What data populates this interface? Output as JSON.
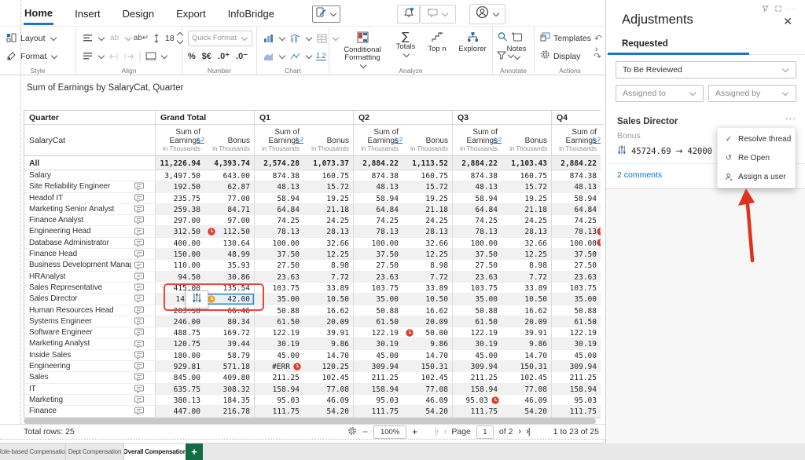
{
  "menu": {
    "items": [
      "Home",
      "Insert",
      "Design",
      "Export",
      "InfoBridge"
    ],
    "active": "Home"
  },
  "ribbon": {
    "style_label": "Style",
    "align_label": "Align",
    "number_label": "Number",
    "chart_label": "Chart",
    "analyze_label": "Analyze",
    "annotate_label": "Annotate",
    "actions_label": "Actions",
    "layout": "Layout",
    "format": "Format",
    "font_size": "18",
    "quick_format": "Quick Format",
    "number_glyphs": [
      "%",
      "$€",
      ".0⁺",
      ".0⁻"
    ],
    "chart_badge": "1.2",
    "conditional_formatting": "Conditional Formatting",
    "totals": "Totals",
    "top_n": "Top n",
    "explorer": "Explorer",
    "notes": "Notes",
    "templates": "Templates",
    "display": "Display"
  },
  "table": {
    "title": "Sum of Earnings by SalaryCat, Quarter",
    "corner_top": "Quarter",
    "corner_bottom": "SalaryCat",
    "quarter_headers": [
      "Grand Total",
      "Q1",
      "Q2",
      "Q3",
      "Q4"
    ],
    "measure": {
      "sum": "Sum of Earnings",
      "bonus": "Bonus",
      "unit": "in Thousands",
      "scale_badge": "1.2"
    },
    "rows": [
      {
        "name": "All",
        "bold": true,
        "shaded": true,
        "values": [
          "11,226.94",
          "4,393.74",
          "2,574.28",
          "1,073.37",
          "2,884.22",
          "1,113.52",
          "2,884.22",
          "1,103.43",
          "2,884.22"
        ]
      },
      {
        "name": "Salary",
        "values": [
          "3,497.50",
          "643.00",
          "874.38",
          "160.75",
          "874.38",
          "160.75",
          "874.38",
          "160.75",
          "874.38"
        ]
      },
      {
        "name": "Site Reliability Engineer",
        "comment": true,
        "shaded": true,
        "values": [
          "192.50",
          "62.87",
          "48.13",
          "15.72",
          "48.13",
          "15.72",
          "48.13",
          "15.72",
          "48.13"
        ]
      },
      {
        "name": "Headof IT",
        "comment": true,
        "values": [
          "235.75",
          "77.00",
          "58.94",
          "19.25",
          "58.94",
          "19.25",
          "58.94",
          "19.25",
          "58.94"
        ]
      },
      {
        "name": "Marketing Senior Analyst",
        "comment": true,
        "shaded": true,
        "values": [
          "259.38",
          "84.71",
          "64.84",
          "21.18",
          "64.84",
          "21.18",
          "64.84",
          "21.18",
          "64.84"
        ]
      },
      {
        "name": "Finance Analyst",
        "comment": true,
        "values": [
          "297.00",
          "97.00",
          "74.25",
          "24.25",
          "74.25",
          "24.25",
          "74.25",
          "24.25",
          "74.25"
        ]
      },
      {
        "name": "Engineering Head",
        "comment": true,
        "shaded": true,
        "values": [
          "312.50",
          "112.50",
          "78.13",
          "28.13",
          "78.13",
          "28.13",
          "78.13",
          "28.13",
          "78.13"
        ],
        "cellIcons": [
          {
            "col": 1,
            "type": "red",
            "pos": "left"
          },
          {
            "col": 8,
            "type": "red",
            "pos": "edge"
          }
        ]
      },
      {
        "name": "Database Administrator",
        "comment": true,
        "values": [
          "400.00",
          "130.64",
          "100.00",
          "32.66",
          "100.00",
          "32.66",
          "100.00",
          "32.66",
          "100.00"
        ],
        "cellIcons": [
          {
            "col": 8,
            "type": "red",
            "pos": "edge"
          }
        ]
      },
      {
        "name": "Finance Head",
        "comment": true,
        "shaded": true,
        "values": [
          "150.00",
          "48.99",
          "37.50",
          "12.25",
          "37.50",
          "12.25",
          "37.50",
          "12.25",
          "37.50"
        ]
      },
      {
        "name": "Business Development Manager",
        "comment": true,
        "values": [
          "110.00",
          "35.93",
          "27.50",
          "8.98",
          "27.50",
          "8.98",
          "27.50",
          "8.98",
          "27.50"
        ]
      },
      {
        "name": "HRAnalyst",
        "comment": true,
        "shaded": true,
        "values": [
          "94.50",
          "30.86",
          "23.63",
          "7.72",
          "23.63",
          "7.72",
          "23.63",
          "7.72",
          "23.63"
        ]
      },
      {
        "name": "Sales Representative",
        "comment": true,
        "values": [
          "415.00",
          "135.54",
          "103.75",
          "33.89",
          "103.75",
          "33.89",
          "103.75",
          "33.89",
          "103.75"
        ]
      },
      {
        "name": "Sales Director",
        "comment": true,
        "shaded": true,
        "values": [
          "14",
          "42.00",
          "35.00",
          "10.50",
          "35.00",
          "10.50",
          "35.00",
          "10.50",
          "35.00"
        ],
        "sel": 1,
        "cut": 0,
        "cellIcons": [
          {
            "col": 1,
            "type": "amber",
            "pos": "left"
          }
        ]
      },
      {
        "name": "Human Resources Head",
        "comment": true,
        "values": [
          "203.50",
          "66.46",
          "50.88",
          "16.62",
          "50.88",
          "16.62",
          "50.88",
          "16.62",
          "50.88"
        ]
      },
      {
        "name": "Systems Engineer",
        "comment": true,
        "shaded": true,
        "values": [
          "246.00",
          "80.34",
          "61.50",
          "20.09",
          "61.50",
          "20.09",
          "61.50",
          "20.09",
          "61.50"
        ]
      },
      {
        "name": "Software Engineer",
        "comment": true,
        "values": [
          "488.75",
          "169.72",
          "122.19",
          "39.91",
          "122.19",
          "50.00",
          "122.19",
          "39.91",
          "122.19"
        ],
        "cellIcons": [
          {
            "col": 5,
            "type": "red",
            "pos": "left"
          }
        ]
      },
      {
        "name": "Marketing Analyst",
        "comment": true,
        "shaded": true,
        "values": [
          "120.75",
          "39.44",
          "30.19",
          "9.86",
          "30.19",
          "9.86",
          "30.19",
          "9.86",
          "30.19"
        ]
      },
      {
        "name": "Inside Sales",
        "comment": true,
        "values": [
          "180.00",
          "58.79",
          "45.00",
          "14.70",
          "45.00",
          "14.70",
          "45.00",
          "14.70",
          "45.00"
        ]
      },
      {
        "name": "Engineering",
        "comment": true,
        "shaded": true,
        "values": [
          "929.81",
          "571.18",
          "#ERR",
          "120.25",
          "309.94",
          "150.31",
          "309.94",
          "150.31",
          "309.94"
        ],
        "cellIcons": [
          {
            "col": 2,
            "type": "red",
            "pos": "right"
          }
        ]
      },
      {
        "name": "Sales",
        "comment": true,
        "values": [
          "845.00",
          "409.80",
          "211.25",
          "102.45",
          "211.25",
          "102.45",
          "211.25",
          "102.45",
          "211.25"
        ]
      },
      {
        "name": "IT",
        "comment": true,
        "shaded": true,
        "values": [
          "635.75",
          "308.32",
          "158.94",
          "77.08",
          "158.94",
          "77.08",
          "158.94",
          "77.08",
          "158.94"
        ]
      },
      {
        "name": "Marketing",
        "comment": true,
        "values": [
          "380.13",
          "184.35",
          "95.03",
          "46.09",
          "95.03",
          "46.09",
          "95.03",
          "46.09",
          "95.03"
        ],
        "cellIcons": [
          {
            "col": 6,
            "type": "red",
            "pos": "right"
          }
        ]
      },
      {
        "name": "Finance",
        "comment": true,
        "shaded": true,
        "values": [
          "447.00",
          "216.78",
          "111.75",
          "54.20",
          "111.75",
          "54.20",
          "111.75",
          "54.20",
          "111.75"
        ]
      }
    ]
  },
  "footer": {
    "total_rows": "Total rows: 25",
    "zoom_value": "100%",
    "page_label": "Page",
    "page_value": "1",
    "of_label": "of 2",
    "range": "1 to 23 of 25"
  },
  "sheetbar": {
    "tabs": [
      "Role-based Compensation",
      "Dept Compensation",
      "Overall Compensation"
    ],
    "active": "Overall Compensation"
  },
  "panel": {
    "title": "Adjustments",
    "tab": "Requested",
    "filter_status": "To Be Reviewed",
    "assigned_to": "Assigned to",
    "assigned_by": "Assigned by",
    "card": {
      "title": "Sales Director",
      "measure": "Bonus",
      "old_value": "45724.69",
      "arrow": "→",
      "new_value": "42000",
      "comments": "2 comments"
    },
    "menu": {
      "items": [
        "Resolve thread",
        "Re Open",
        "Assign a user"
      ]
    }
  },
  "colors": {
    "accent_blue": "#1b74c5",
    "selection_blue": "#3585c6",
    "pending_red": "#e03c32",
    "adjusted_amber": "#eda12c",
    "annotation_red": "#e8453c",
    "sheet_green": "#146c43",
    "link_blue": "#0a6ed1"
  },
  "icons": {
    "edit": "pencil-page",
    "notifications": "bell-with-dot",
    "add_comment": "comment-plus",
    "account": "person-circle",
    "panel_filter": "funnel",
    "panel_expand": "expand",
    "overflow": "ellipsis",
    "close": "x",
    "resolve": "check",
    "reopen": "undo-arrow",
    "assign": "person-arrow",
    "adjust": "sliders",
    "pending": "red-clock",
    "adjusted": "amber-clock",
    "row_comment": "speech-bubble",
    "settings": "gear"
  }
}
